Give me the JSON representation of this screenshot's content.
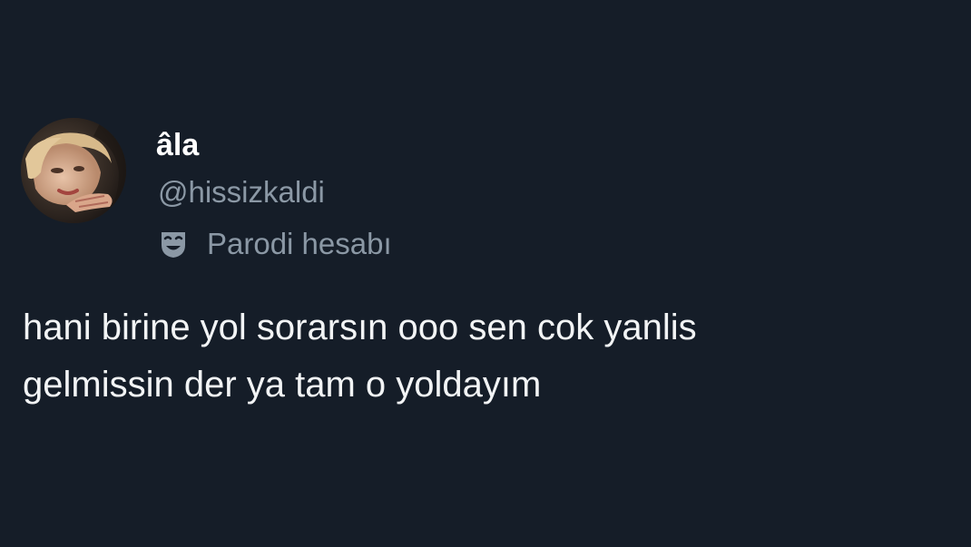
{
  "author": {
    "display_name": "âla",
    "handle": "@hissizkaldi",
    "avatar_icon": "profile-photo"
  },
  "badge": {
    "icon": "theater-mask-icon",
    "label": "Parodi hesabı"
  },
  "tweet": {
    "lines": [
      "hani birine yol sorarsın ooo sen cok yanlis",
      "gelmissin der ya tam o yoldayım"
    ]
  },
  "colors": {
    "background": "#151d28",
    "primary_text": "#ffffff",
    "secondary_text": "#8b98a5"
  }
}
